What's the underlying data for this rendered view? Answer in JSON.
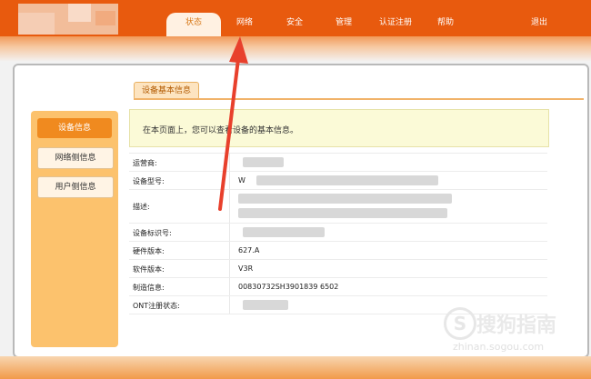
{
  "nav": {
    "items": [
      {
        "label": "状态"
      },
      {
        "label": "网络"
      },
      {
        "label": "安全"
      },
      {
        "label": "管理"
      },
      {
        "label": "认证注册"
      },
      {
        "label": "帮助"
      }
    ],
    "logout": "退出"
  },
  "tab": {
    "label": "设备基本信息"
  },
  "sidebar": {
    "items": [
      {
        "label": "设备信息"
      },
      {
        "label": "网络侧信息"
      },
      {
        "label": "用户侧信息"
      }
    ]
  },
  "notice": {
    "text": "在本页面上，您可以查看设备的基本信息。"
  },
  "table": {
    "rows": [
      {
        "key": "运营商:",
        "value": ""
      },
      {
        "key": "设备型号:",
        "value": "W"
      },
      {
        "key": "描述:",
        "value": ""
      },
      {
        "key": "设备标识号:",
        "value": ""
      },
      {
        "key": "硬件版本:",
        "value": "627.A"
      },
      {
        "key": "软件版本:",
        "value": "V3R"
      },
      {
        "key": "制造信息:",
        "value": "00830732SH3901839 6502"
      },
      {
        "key": "ONT注册状态:",
        "value": ""
      }
    ]
  },
  "watermark": {
    "brand": "搜狗指南",
    "url": "zhinan.sogou.com",
    "glyph": "S"
  },
  "colors": {
    "topbar": "#e85a0e",
    "accent": "#f08a1f",
    "arrow": "#e8402c"
  }
}
